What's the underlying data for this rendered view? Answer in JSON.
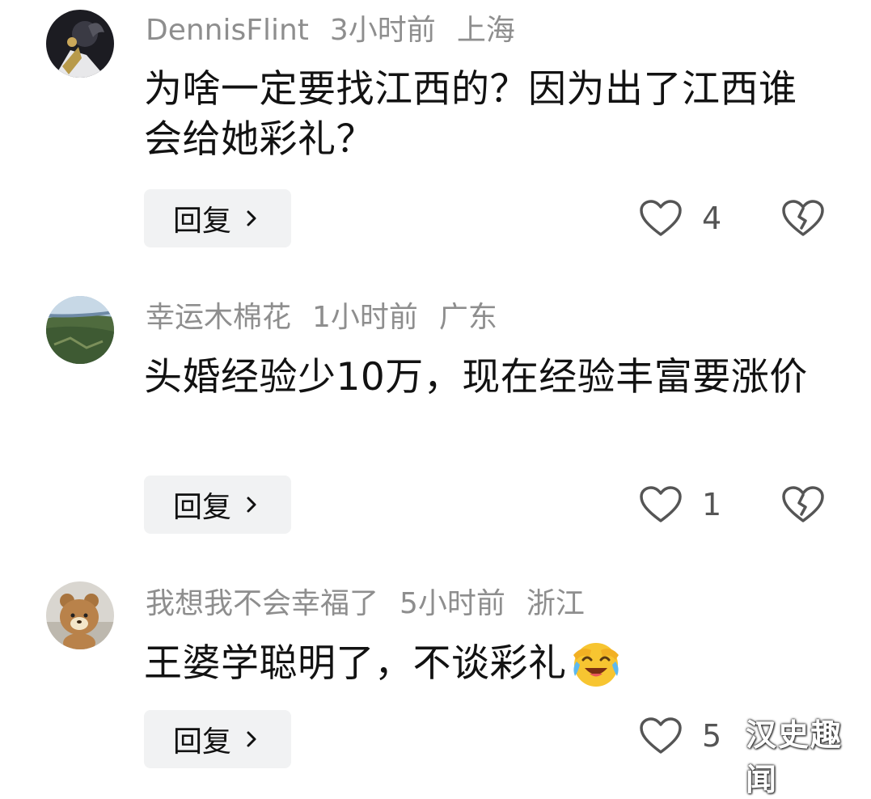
{
  "comments": [
    {
      "username": "DennisFlint",
      "time": "3小时前",
      "location": "上海",
      "text": "为啥一定要找江西的？因为出了江西谁会给她彩礼？",
      "reply_label": "回复",
      "likes": "4",
      "avatar_icon": "dark-fantasy-character-avatar"
    },
    {
      "username": "幸运木棉花",
      "time": "1小时前",
      "location": "广东",
      "text": "头婚经验少10万，现在经验丰富要涨价",
      "reply_label": "回复",
      "likes": "1",
      "avatar_icon": "aerial-landscape-avatar"
    },
    {
      "username": "我想我不会幸福了",
      "time": "5小时前",
      "location": "浙江",
      "text": "王婆学聪明了，不谈彩礼",
      "reply_label": "回复",
      "likes": "5",
      "avatar_icon": "bear-plush-avatar",
      "emoji": "laughing-crying-emoji"
    }
  ],
  "icons": {
    "like": "heart-outline-icon",
    "dislike": "broken-heart-icon",
    "chevron": "chevron-right-icon"
  },
  "watermark": "汉史趣闻",
  "colors": {
    "meta": "#8e8e8e",
    "text": "#121212",
    "reply_bg": "#f1f2f3",
    "icon": "#555555"
  }
}
